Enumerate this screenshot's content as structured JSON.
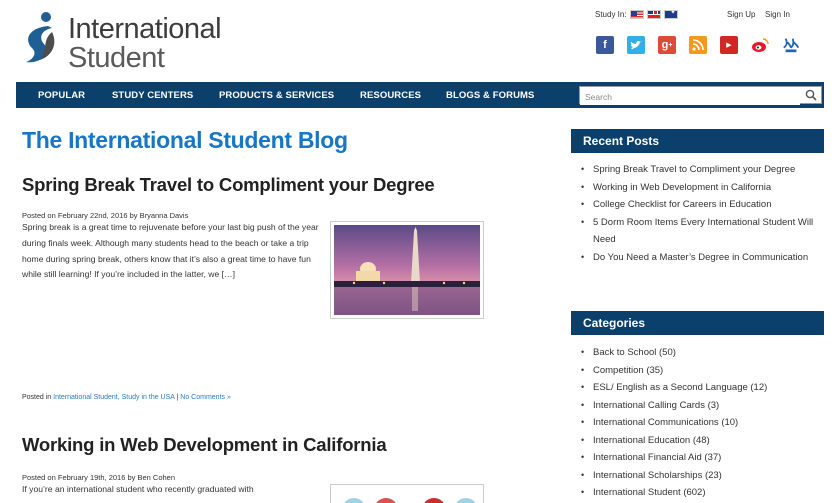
{
  "logo": {
    "line1": "International",
    "line2": "Student"
  },
  "header": {
    "study_in_label": "Study In:",
    "sign_up": "Sign Up",
    "sign_in": "Sign In",
    "social_icons": [
      "facebook-icon",
      "twitter-icon",
      "google-plus-icon",
      "rss-icon",
      "youtube-icon",
      "weibo-icon",
      "renren-icon"
    ]
  },
  "nav": {
    "items": [
      "POPULAR",
      "STUDY CENTERS",
      "PRODUCTS & SERVICES",
      "RESOURCES",
      "BLOGS & FORUMS"
    ],
    "search_placeholder": "Search"
  },
  "blog": {
    "title": "The International Student Blog",
    "posts": [
      {
        "title": "Spring Break Travel to Compliment your Degree",
        "meta": "Posted on February 22nd, 2016 by Bryanna Davis",
        "excerpt": "Spring break is a great time to rejuvenate before your last big push of the year during finals week. Although many students head to the beach or take a trip home during spring break, others know that it’s also a great time to have fun while still learning! If you’re included in the latter, we […]",
        "footer_prefix": "Posted in ",
        "categories": "International Student, Study in the USA",
        "separator": " | ",
        "comments": "No Comments »"
      },
      {
        "title": "Working in Web Development in California",
        "meta": "Posted on February 19th, 2016 by Ben Cohen",
        "excerpt": "If you’re an international student who recently graduated with"
      }
    ]
  },
  "sidebar": {
    "recent_title": "Recent Posts",
    "recent": [
      "Spring Break Travel to Compliment your Degree",
      "Working in Web Development in California",
      "College Checklist for Careers in Education",
      "5 Dorm Room Items Every International Student Will Need",
      "Do You Need a Master’s Degree in Communication"
    ],
    "categories_title": "Categories",
    "categories": [
      "Back to School (50)",
      "Competition (35)",
      "ESL/ English as a Second Language (12)",
      "International Calling Cards (3)",
      "International Communications (10)",
      "International Education (48)",
      "International Financial Aid (37)",
      "International Scholarships (23)",
      "International Student (602)"
    ]
  },
  "colors": {
    "brand_blue": "#0b3f6c",
    "title_blue": "#1976c6",
    "link_blue": "#2a7ac8"
  }
}
